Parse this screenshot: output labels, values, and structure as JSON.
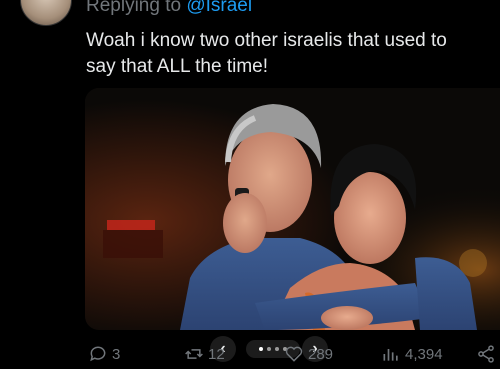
{
  "reply": {
    "prefix": "Replying to",
    "handle": "@Israel"
  },
  "tweet": {
    "text_line1": "Woah i know two other israelis that used to",
    "text_line2": "say that ALL the time!"
  },
  "media": {
    "description_icon": "photo",
    "gallery_dots": 4,
    "active_dot": 0
  },
  "actions": {
    "replies": "3",
    "retweets": "12",
    "likes": "289",
    "views": "4,394"
  },
  "icons": {
    "reply": "reply-icon",
    "retweet": "retweet-icon",
    "like": "heart-icon",
    "views": "views-icon",
    "share": "share-icon"
  },
  "colors": {
    "background": "#000000",
    "text": "#e7e9ea",
    "muted": "#71767b",
    "link": "#1d9bf0"
  }
}
